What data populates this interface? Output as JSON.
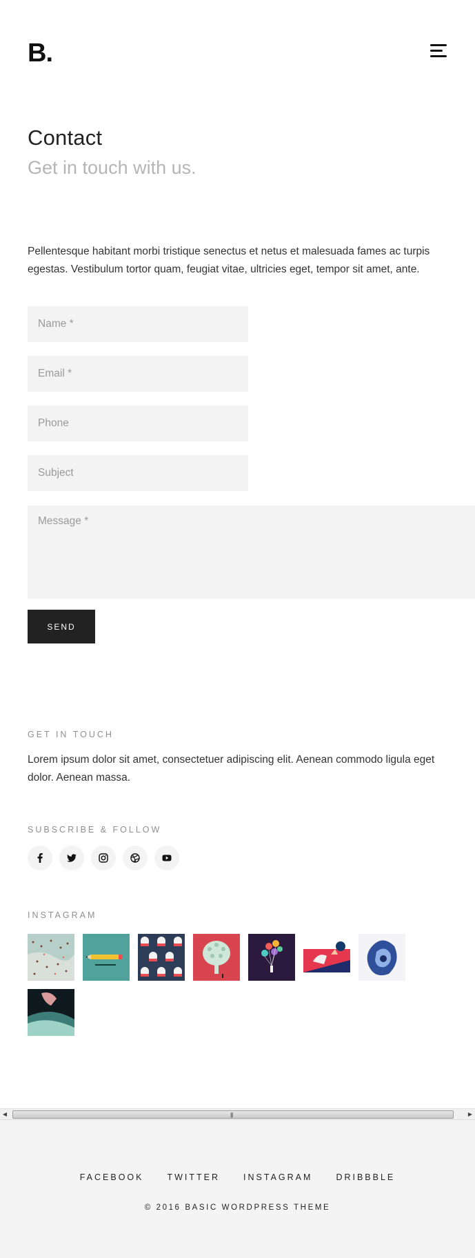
{
  "header": {
    "logo": "B.",
    "menu_icon": "hamburger-menu-icon"
  },
  "page": {
    "title": "Contact",
    "subtitle": "Get in touch with us."
  },
  "intro": "Pellentesque habitant morbi tristique senectus et netus et malesuada fames ac turpis egestas. Vestibulum tortor quam, feugiat vitae, ultricies eget, tempor sit amet, ante.",
  "form": {
    "name_placeholder": "Name *",
    "email_placeholder": "Email *",
    "phone_placeholder": "Phone",
    "subject_placeholder": "Subject",
    "message_placeholder": "Message *",
    "send_label": "SEND"
  },
  "get_in_touch": {
    "heading": "GET IN TOUCH",
    "text": "Lorem ipsum dolor sit amet, consectetuer adipiscing elit. Aenean commodo ligula eget dolor. Aenean massa."
  },
  "follow": {
    "heading": "SUBSCRIBE & FOLLOW",
    "icons": [
      "facebook-icon",
      "twitter-icon",
      "instagram-icon",
      "dribbble-icon",
      "youtube-icon"
    ]
  },
  "instagram": {
    "heading": "INSTAGRAM",
    "count": 8
  },
  "footer": {
    "links": [
      "FACEBOOK",
      "TWITTER",
      "INSTAGRAM",
      "DRIBBBLE"
    ],
    "copyright": "© 2016 BASIC WORDPRESS THEME"
  },
  "colors": {
    "accent": "#222222",
    "field_bg": "#f3f3f3",
    "muted": "#b5b5b5",
    "footer_bg": "#f4f4f4"
  }
}
